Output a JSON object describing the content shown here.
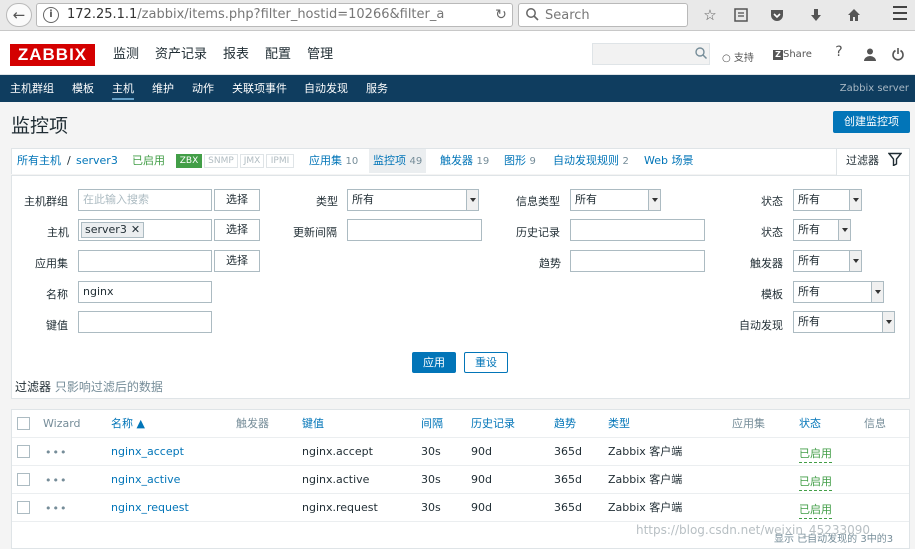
{
  "browser": {
    "url_host": "172.25.1.1",
    "url_path": "/zabbix/items.php?filter_hostid=10266&filter_a",
    "search_placeholder": "Search"
  },
  "header": {
    "logo": "ZABBIX",
    "menu": [
      "监测",
      "资产记录",
      "报表",
      "配置",
      "管理"
    ],
    "support": "支持",
    "share": "Share",
    "help": "?"
  },
  "subnav": {
    "items": [
      "主机群组",
      "模板",
      "主机",
      "维护",
      "动作",
      "关联项事件",
      "自动发现",
      "服务"
    ],
    "server": "Zabbix server"
  },
  "page": {
    "title": "监控项",
    "create_button": "创建监控项"
  },
  "hostnav": {
    "all_hosts": "所有主机",
    "sep": "/",
    "host": "server3",
    "status": "已启用",
    "avail": [
      "ZBX",
      "SNMP",
      "JMX",
      "IPMI"
    ],
    "apps": "应用集",
    "apps_count": "10",
    "items": "监控项",
    "items_count": "49",
    "triggers": "触发器",
    "triggers_count": "19",
    "graphs": "图形",
    "graphs_count": "9",
    "discovery": "自动发现规则",
    "discovery_count": "2",
    "web": "Web 场景",
    "filter": "过滤器"
  },
  "filter": {
    "host_group_label": "主机群组",
    "host_group_placeholder": "在此输入搜索",
    "select": "选择",
    "host_label": "主机",
    "host_chip": "server3",
    "app_label": "应用集",
    "name_label": "名称",
    "name_value": "nginx",
    "key_label": "键值",
    "type_label": "类型",
    "type_value": "所有",
    "interval_label": "更新间隔",
    "info_type_label": "信息类型",
    "info_type_value": "所有",
    "history_label": "历史记录",
    "trends_label": "趋势",
    "state_label": "状态",
    "state_value": "所有",
    "status_label": "状态",
    "status_value": "所有",
    "triggers_label": "触发器",
    "triggers_value": "所有",
    "template_label": "模板",
    "template_value": "所有",
    "discovery_label": "自动发现",
    "discovery_value": "所有",
    "apply": "应用",
    "reset": "重设",
    "note_main": "过滤器",
    "note_sub": "只影响过滤后的数据"
  },
  "table": {
    "headers": {
      "wizard": "Wizard",
      "name": "名称 ▲",
      "triggers": "触发器",
      "key": "键值",
      "interval": "间隔",
      "history": "历史记录",
      "trends": "趋势",
      "type": "类型",
      "apps": "应用集",
      "status": "状态",
      "info": "信息"
    },
    "rows": [
      {
        "name": "nginx_accept",
        "key": "nginx.accept",
        "interval": "30s",
        "history": "90d",
        "trends": "365d",
        "type": "Zabbix 客户端",
        "status": "已启用"
      },
      {
        "name": "nginx_active",
        "key": "nginx.active",
        "interval": "30s",
        "history": "90d",
        "trends": "365d",
        "type": "Zabbix 客户端",
        "status": "已启用"
      },
      {
        "name": "nginx_request",
        "key": "nginx.request",
        "interval": "30s",
        "history": "90d",
        "trends": "365d",
        "type": "Zabbix 客户端",
        "status": "已启用"
      }
    ],
    "footer": "显示 已自动发现的 3中的3"
  },
  "watermark": "https://blog.csdn.net/weixin_45233090",
  "colors": {
    "accent": "#0275b8",
    "header_nav": "#0f3d5f",
    "logo": "#d40000",
    "enabled": "#429e47"
  }
}
